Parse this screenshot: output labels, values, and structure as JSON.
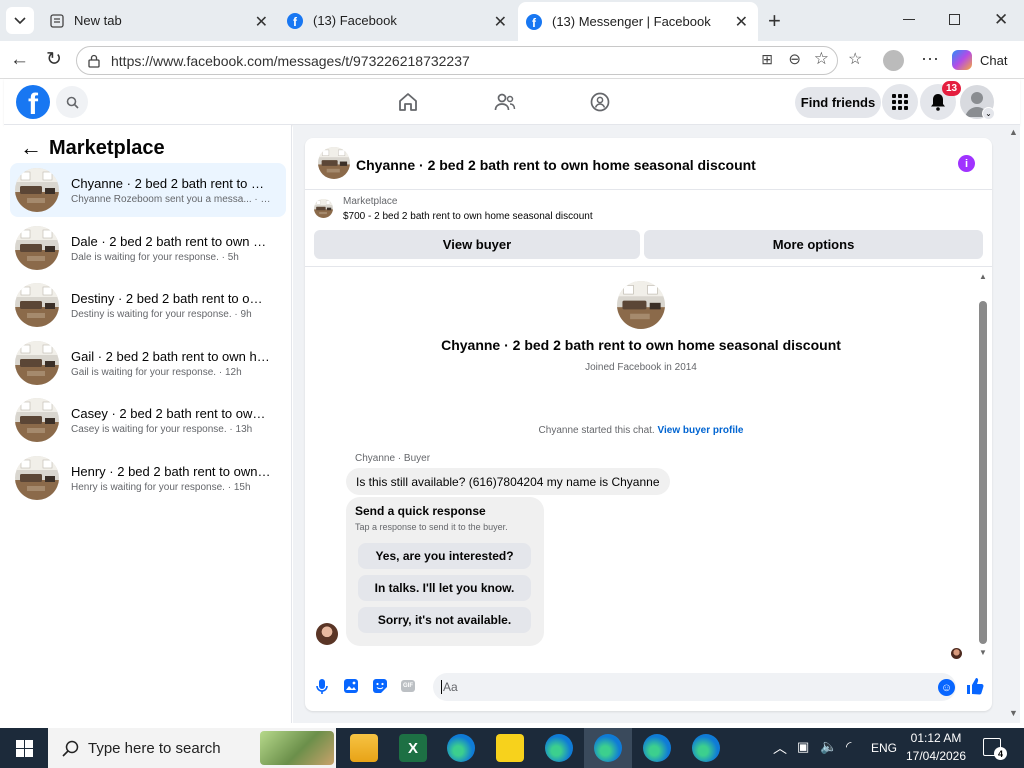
{
  "browser": {
    "tabs": [
      {
        "label": "New tab"
      },
      {
        "label": "(13) Facebook"
      },
      {
        "label": "(13) Messenger | Facebook"
      }
    ],
    "url": "https://www.facebook.com/messages/t/973226218732237",
    "chat_label": "Chat"
  },
  "fb_header": {
    "find_friends": "Find friends",
    "notification_count": "13"
  },
  "sidebar": {
    "title": "Marketplace",
    "conversations": [
      {
        "name": "Chyanne · 2 bed 2 bath rent to ow...",
        "sub": "Chyanne Rozeboom sent you a messa... · 4h"
      },
      {
        "name": "Dale · 2 bed 2 bath rent to own ho...",
        "sub": "Dale is waiting for your response. · 5h"
      },
      {
        "name": "Destiny · 2 bed 2 bath rent to own...",
        "sub": "Destiny is waiting for your response. · 9h"
      },
      {
        "name": "Gail · 2 bed 2 bath rent to own ho...",
        "sub": "Gail is waiting for your response. · 12h"
      },
      {
        "name": "Casey · 2 bed 2 bath rent to own h...",
        "sub": "Casey is waiting for your response. · 13h"
      },
      {
        "name": "Henry · 2 bed 2 bath rent to own h...",
        "sub": "Henry is waiting for your response. · 15h"
      }
    ]
  },
  "chat": {
    "header_title": "Chyanne · 2 bed 2 bath rent to own home seasonal discount",
    "listing_source": "Marketplace",
    "listing_desc": "$700 - 2 bed 2 bath rent to own home seasonal discount",
    "view_buyer": "View buyer",
    "more_options": "More options",
    "profile_title": "Chyanne · 2 bed 2 bath rent to own home seasonal discount",
    "joined": "Joined Facebook in 2014",
    "started_text": "Chyanne started this chat.",
    "view_buyer_profile": "View buyer profile",
    "sender_label": "Chyanne · Buyer",
    "message": "Is this still available? (616)7804204 my name is Chyanne",
    "quick_title": "Send a quick response",
    "quick_sub": "Tap a response to send it to the buyer.",
    "quick_responses": [
      "Yes, are you interested?",
      "In talks. I'll let you know.",
      "Sorry, it's not available."
    ],
    "composer_placeholder": "Aa"
  },
  "taskbar": {
    "search_placeholder": "Type here to search",
    "language": "ENG",
    "time": "01:12 AM",
    "date": "17/04/2026",
    "notif_count": "4"
  },
  "colors": {
    "fb_blue": "#1877f2",
    "link_blue": "#0064d1",
    "badge_red": "#e41e3f",
    "info_purple": "#a033ff"
  }
}
